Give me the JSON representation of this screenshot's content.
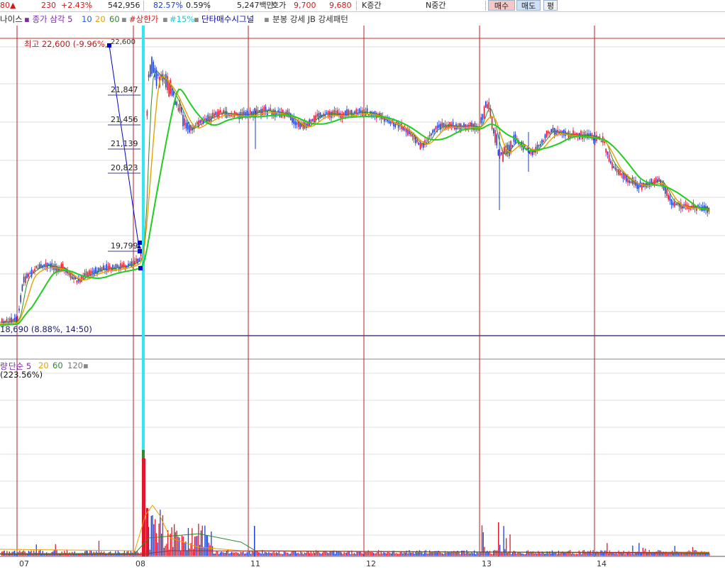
{
  "topbar": {
    "price_partial": "80",
    "change_arrow": "▲",
    "change": "230",
    "change_pct": "+2.43%",
    "volume": "542,956",
    "vol_ratio": "82.57%",
    "turnover": "0.59%",
    "trade_value": "5,247백만",
    "quote_label": "호가",
    "ask": "9,700",
    "bid": "9,680",
    "broker1": "K증간",
    "broker2": "N중간",
    "buy_label": "매수",
    "sell_label": "매도",
    "flat_label": "평"
  },
  "price_legend": {
    "source_partial": "나이스",
    "ma_label": "종가 삼각 5",
    "ma10": "10",
    "ma20": "20",
    "ma60": "60",
    "limit_up": "#상한가",
    "pct15": "#15%",
    "signal": "단타매수시그널",
    "patterns": "분봉 강세 JB 강세패턴"
  },
  "annotations": {
    "high_label": "최고 22,600 (-9.96%,",
    "high_value": "22,600",
    "low_label": "18,690 (8.88%, 14:50)",
    "fib": [
      "21,847",
      "21,456",
      "21,139",
      "20,823",
      "19,799"
    ]
  },
  "volume_legend": {
    "prefix": "량",
    "ma_label": "단순 5",
    "ma20": "20",
    "ma60": "60",
    "ma120": "120",
    "pct": "(223.56%)"
  },
  "x_axis": [
    "07",
    "08",
    "11",
    "12",
    "13",
    "14"
  ],
  "colors": {
    "up": "#e0182d",
    "down": "#1d3fd0",
    "ma5": "#2d8a2d",
    "ma20": "#e8a000",
    "ma60": "#22cc22",
    "vline": "#b22222",
    "cyan": "#33e6f0",
    "signal": "#0000cc",
    "legend_purple": "#7a2da8",
    "legend_blue": "#2e5fd6"
  }
}
